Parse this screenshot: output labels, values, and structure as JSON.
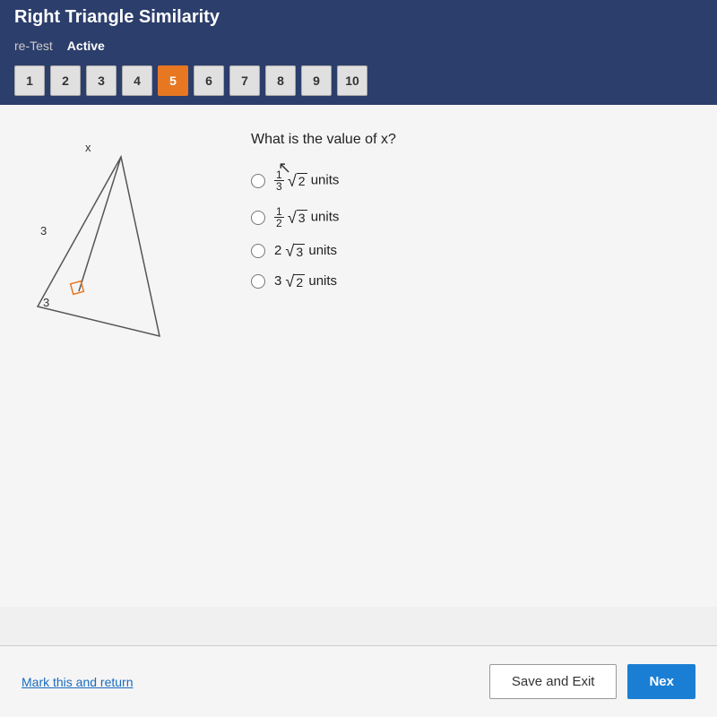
{
  "header": {
    "title": "Right Triangle Similarity"
  },
  "subheader": {
    "test_label": "re-Test",
    "status_label": "Active"
  },
  "tabs": {
    "items": [
      {
        "label": "1",
        "active": false
      },
      {
        "label": "2",
        "active": false
      },
      {
        "label": "3",
        "active": false
      },
      {
        "label": "4",
        "active": false
      },
      {
        "label": "5",
        "active": true
      },
      {
        "label": "6",
        "active": false
      },
      {
        "label": "7",
        "active": false
      },
      {
        "label": "8",
        "active": false
      },
      {
        "label": "9",
        "active": false
      },
      {
        "label": "10",
        "active": false
      }
    ]
  },
  "question": {
    "text": "What is the value of x?",
    "options": [
      {
        "id": "opt1",
        "label": "1/3 √2 units"
      },
      {
        "id": "opt2",
        "label": "1/2 √3 units"
      },
      {
        "id": "opt3",
        "label": "2√3 units"
      },
      {
        "id": "opt4",
        "label": "3√2 units"
      }
    ],
    "diagram_labels": {
      "x": "x",
      "side1": "3",
      "side2": "3"
    }
  },
  "footer": {
    "mark_label": "Mark this and return",
    "save_exit_label": "Save and Exit",
    "next_label": "Nex"
  }
}
